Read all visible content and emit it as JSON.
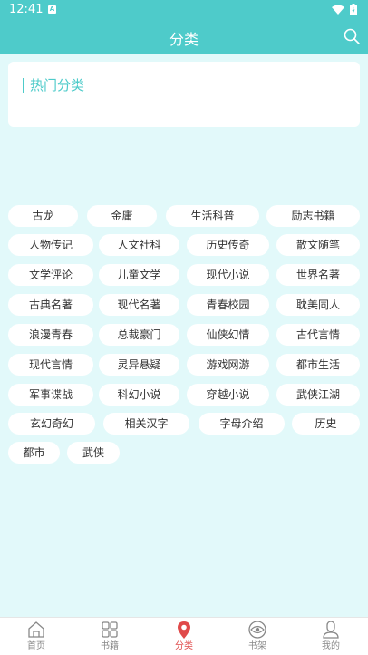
{
  "status": {
    "time": "12:41"
  },
  "header": {
    "title": "分类"
  },
  "hot": {
    "title": "热门分类"
  },
  "tags": [
    "古龙",
    "金庸",
    "生活科普",
    "励志书籍",
    "人物传记",
    "人文社科",
    "历史传奇",
    "散文随笔",
    "文学评论",
    "儿童文学",
    "现代小说",
    "世界名著",
    "古典名著",
    "现代名著",
    "青春校园",
    "耽美同人",
    "浪漫青春",
    "总裁豪门",
    "仙侠幻情",
    "古代言情",
    "现代言情",
    "灵异悬疑",
    "游戏网游",
    "都市生活",
    "军事谍战",
    "科幻小说",
    "穿越小说",
    "武侠江湖",
    "玄幻奇幻",
    "相关汉字",
    "字母介绍",
    "历史",
    "都市",
    "武侠"
  ],
  "nav": [
    {
      "label": "首页",
      "icon": "home-icon"
    },
    {
      "label": "书籍",
      "icon": "grid-icon"
    },
    {
      "label": "分类",
      "icon": "location-pin-icon",
      "active": true
    },
    {
      "label": "书架",
      "icon": "eye-icon"
    },
    {
      "label": "我的",
      "icon": "person-icon"
    }
  ],
  "colors": {
    "accent": "#4ecbca",
    "background": "#e2f9fa",
    "active": "#e04a4a"
  }
}
